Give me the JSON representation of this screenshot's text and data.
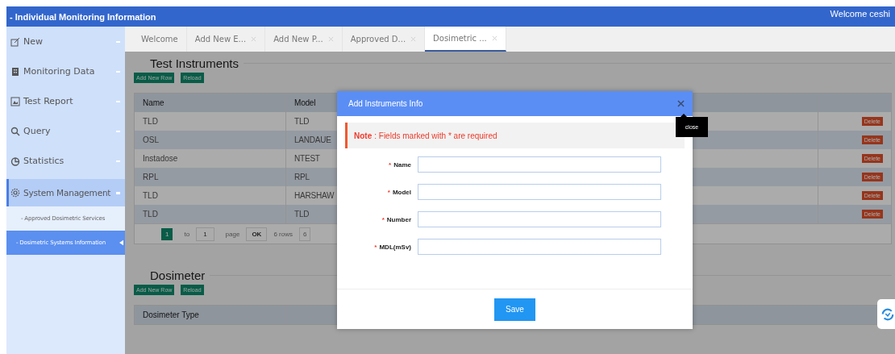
{
  "header": {
    "title": "- Individual Monitoring Information",
    "welcome": "Welcome ceshi"
  },
  "sidebar": {
    "items": [
      {
        "label": "New",
        "selected": false,
        "expanded": false
      },
      {
        "label": "Monitoring Data",
        "selected": false,
        "expanded": false
      },
      {
        "label": "Test Report",
        "selected": false,
        "expanded": false
      },
      {
        "label": "Query",
        "selected": false,
        "expanded": false
      },
      {
        "label": "Statistics",
        "selected": false,
        "expanded": false
      },
      {
        "label": "System Management",
        "selected": true,
        "expanded": true,
        "children": [
          {
            "label": "- Approved Dosimetric Services",
            "selected": false
          },
          {
            "label": "- Dosimetric Systems Information",
            "selected": true
          }
        ]
      }
    ]
  },
  "tabs": [
    {
      "label": "Welcome",
      "closable": false,
      "selected": false
    },
    {
      "label": "Add New E...",
      "closable": true,
      "selected": false
    },
    {
      "label": "Add New P...",
      "closable": true,
      "selected": false
    },
    {
      "label": "Approved D...",
      "closable": true,
      "selected": false
    },
    {
      "label": "Dosimetric ...",
      "closable": true,
      "selected": true
    }
  ],
  "instruments": {
    "title": "Test Instruments",
    "buttons": [
      "Add New Row",
      "Reload"
    ],
    "columns": [
      "Name",
      "Model"
    ],
    "rows": [
      {
        "cells": [
          "TLD",
          "TLD"
        ],
        "action": "Delete"
      },
      {
        "cells": [
          "OSL",
          "LANDAUE"
        ],
        "action": "Delete"
      },
      {
        "cells": [
          "Instadose",
          "NTEST"
        ],
        "action": "Delete"
      },
      {
        "cells": [
          "RPL",
          "RPL"
        ],
        "action": "Delete"
      },
      {
        "cells": [
          "TLD",
          "HARSHAW"
        ],
        "action": "Delete"
      },
      {
        "cells": [
          "TLD",
          "TLD"
        ],
        "action": "Delete"
      }
    ],
    "pager": {
      "page": "1",
      "to": "to",
      "page_input": "1",
      "page_word": "page",
      "ok": "OK",
      "rows": "6 rows",
      "size": "6"
    }
  },
  "dosimeter": {
    "title": "Dosimeter",
    "buttons": [
      "Add New Row",
      "Reload"
    ],
    "columns": [
      "Dosimeter Type"
    ]
  },
  "dialog": {
    "title": "Add Instruments Info",
    "close_tooltip": "close",
    "note_label": "Note",
    "note_text": ": Fields marked with * are required",
    "required_mark": "*",
    "fields": [
      {
        "label": "Name",
        "required": true
      },
      {
        "label": "Model",
        "required": true
      },
      {
        "label": "Number",
        "required": true
      },
      {
        "label": "MDL(mSv)",
        "required": true
      }
    ],
    "save": "Save"
  }
}
